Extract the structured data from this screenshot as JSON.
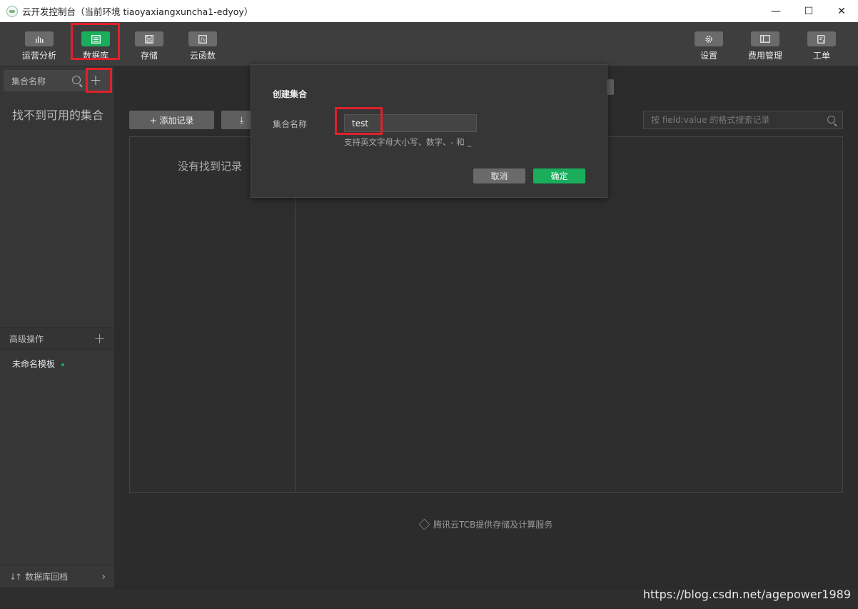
{
  "window": {
    "title": "云开发控制台（当前环境 tiaoyaxiangxuncha1-edyoy）",
    "minimize": "—",
    "maximize": "☐",
    "close": "✕"
  },
  "toolbar": {
    "left": [
      {
        "label": "运营分析",
        "icon": "bar-chart-icon"
      },
      {
        "label": "数据库",
        "icon": "database-icon",
        "active": true
      },
      {
        "label": "存储",
        "icon": "storage-icon"
      },
      {
        "label": "云函数",
        "icon": "cloud-function-icon"
      }
    ],
    "right": [
      {
        "label": "设置",
        "icon": "gear-icon"
      },
      {
        "label": "费用管理",
        "icon": "billing-icon"
      },
      {
        "label": "工单",
        "icon": "ticket-icon"
      }
    ]
  },
  "sidebar": {
    "collection_header": "集合名称",
    "add": "+",
    "empty_text": "找不到可用的集合",
    "advanced_header": "高级操作",
    "advanced_add": "+",
    "template_item": "未命名模板",
    "footer_label": "数据库回档",
    "footer_icon": "↓↑",
    "footer_chevron": "›"
  },
  "main": {
    "add_record_button": "+ 添加记录",
    "import_icon": "⤓",
    "search_placeholder": "按 field:value 的格式搜索记录",
    "no_records": "没有找到记录",
    "footer_note": "腾讯云TCB提供存储及计算服务"
  },
  "modal": {
    "title": "创建集合",
    "field_label": "集合名称",
    "field_value": "test",
    "hint": "支持英文字母大小写、数字、- 和 _",
    "cancel": "取消",
    "ok": "确定"
  },
  "watermark": "https://blog.csdn.net/agepower1989",
  "colors": {
    "accent": "#1aad5c",
    "highlight": "#e0212b",
    "background": "#2c2c2c"
  }
}
